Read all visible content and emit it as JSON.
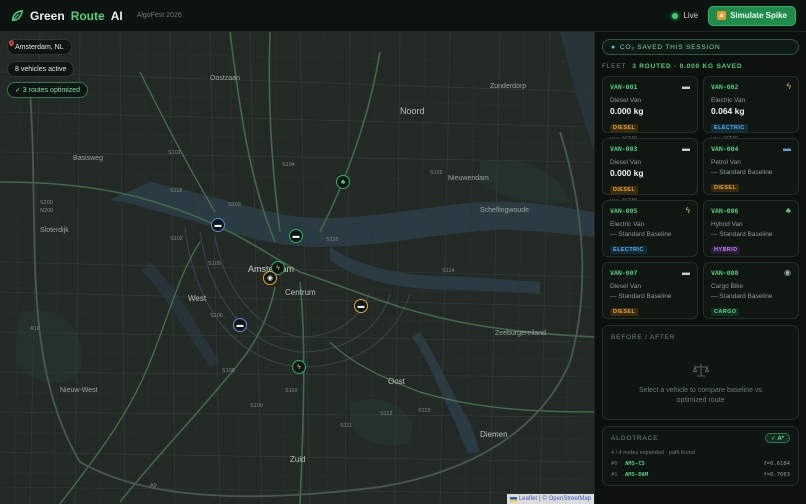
{
  "header": {
    "brand_green": "Green",
    "brand_route": "Route",
    "brand_ai": "AI",
    "tag": "AlgoFest 2026",
    "live_label": "Live",
    "spike_label": "Simulate Spike"
  },
  "map": {
    "location": "Amsterdam, NL",
    "vehicles_active": "8 vehicles active",
    "routes_optimized": "✓ 3 routes optimized",
    "city_label": "Amsterdam",
    "labels": {
      "zunderdorp": "Zunderdorp",
      "noord": "Noord",
      "oostzaan": "Oostzaan",
      "basisweg": "Basisweg",
      "nieuwendam": "Nieuwendam",
      "schellingwoude": "Schellingwoude",
      "centrum": "Centrum",
      "west": "West",
      "oost": "Oost",
      "zeeburgereiland": "Zeeburgereiland",
      "zuid": "Zuid",
      "diemen": "Diemen",
      "sloterdijk": "Sloterdijk",
      "nieuw_west": "Nieuw-West"
    },
    "road_labels": [
      "S101",
      "S102",
      "S103",
      "S104",
      "S105",
      "S106",
      "S108",
      "S109",
      "S110",
      "S111",
      "S112",
      "S113",
      "S114",
      "S115",
      "S116",
      "S118",
      "S200",
      "N200",
      "A10",
      "A9"
    ],
    "attribution_leaflet": "Leaflet",
    "attribution_sep": "|",
    "attribution_osm": "© OpenStreetMap"
  },
  "panel": {
    "co2_banner": "CO₂ SAVED THIS SESSION",
    "fleet_label": "FLEET",
    "fleet_count": "3 ROUTED · 0.000 KG SAVED",
    "vehicles": [
      {
        "id": "VAN-001",
        "type": "Diesel Van",
        "value": "0.000 kg",
        "badge": "DIESEL",
        "badge_class": "diesel",
        "via": "via ASTAR",
        "icon": "truck-icon"
      },
      {
        "id": "VAN-002",
        "type": "Electric Van",
        "value": "0.064 kg",
        "badge": "ELECTRIC",
        "badge_class": "electric",
        "via": "via ASTAR",
        "icon": "bolt-icon"
      },
      {
        "id": "VAN-003",
        "type": "Diesel Van",
        "value": "0.000 kg",
        "badge": "DIESEL",
        "badge_class": "diesel",
        "via": "via ASTAR",
        "icon": "truck-icon"
      },
      {
        "id": "VAN-004",
        "type": "Petrol Van",
        "baseline": "— Standard Baseline",
        "badge": "DIESEL",
        "badge_class": "diesel",
        "icon": "car-icon"
      },
      {
        "id": "VAN-005",
        "type": "Electric Van",
        "baseline": "— Standard Baseline",
        "badge": "ELECTRIC",
        "badge_class": "electric",
        "icon": "bolt-icon"
      },
      {
        "id": "VAN-006",
        "type": "Hybrid Van",
        "baseline": "— Standard Baseline",
        "badge": "HYBRID",
        "badge_class": "hybrid",
        "icon": "leaf-icon"
      },
      {
        "id": "VAN-007",
        "type": "Diesel Van",
        "baseline": "— Standard Baseline",
        "badge": "DIESEL",
        "badge_class": "diesel",
        "icon": "truck-icon"
      },
      {
        "id": "VAN-008",
        "type": "Cargo Bike",
        "baseline": "— Standard Baseline",
        "badge": "CARGO",
        "badge_class": "cargo",
        "icon": "bike-icon"
      }
    ],
    "before_after_title": "BEFORE / AFTER",
    "before_after_msg": "Select a vehicle to compare baseline vs optimized route",
    "algotrace_title": "ALGOTRACE",
    "algotrace_badge": "✓ A*",
    "algotrace_sub": "4 / 4 nodes expanded · path found",
    "trace": [
      {
        "idx": "#0",
        "node": "AMS-CS",
        "f": "f=0.6184"
      },
      {
        "idx": "#1",
        "node": "AMS-DAM",
        "f": "f=0.7063"
      }
    ]
  },
  "colors": {
    "accent": "#4fd27a",
    "panel_bg": "#0c110e",
    "map_bg": "#1f2622",
    "amber": "#e5a82b",
    "blue": "#5a8de0"
  }
}
